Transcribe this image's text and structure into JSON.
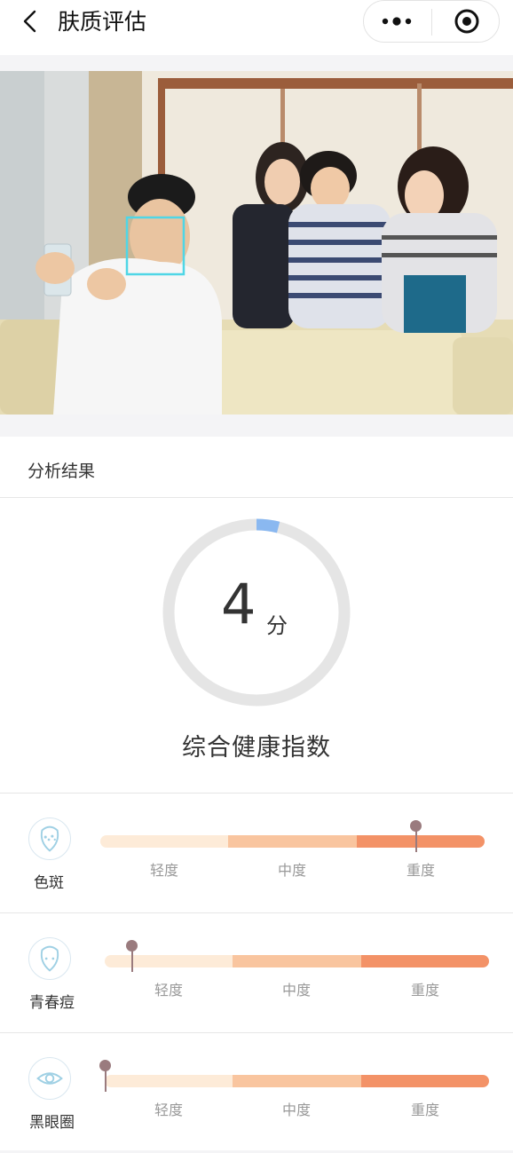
{
  "header": {
    "title": "肤质评估"
  },
  "result": {
    "section_title": "分析结果",
    "score": "4",
    "score_unit": "分",
    "score_value": 4,
    "score_max": 100,
    "score_label": "综合健康指数"
  },
  "metrics": [
    {
      "name": "色斑",
      "icon": "spots-face-icon",
      "level_fraction": 0.82,
      "levels": [
        "轻度",
        "中度",
        "重度"
      ]
    },
    {
      "name": "青春痘",
      "icon": "acne-face-icon",
      "level_fraction": 0.07,
      "levels": [
        "轻度",
        "中度",
        "重度"
      ]
    },
    {
      "name": "黑眼圈",
      "icon": "eye-icon",
      "level_fraction": 0.0,
      "levels": [
        "轻度",
        "中度",
        "重度"
      ]
    }
  ],
  "colors": {
    "ring_track": "#e5e5e5",
    "ring_progress": "#8ab8f0",
    "bar_light": "#fdebd8",
    "bar_mid": "#f9c59f",
    "bar_heavy": "#f39267",
    "pin": "#9a7b7e",
    "face_box": "#4fd6e6"
  }
}
